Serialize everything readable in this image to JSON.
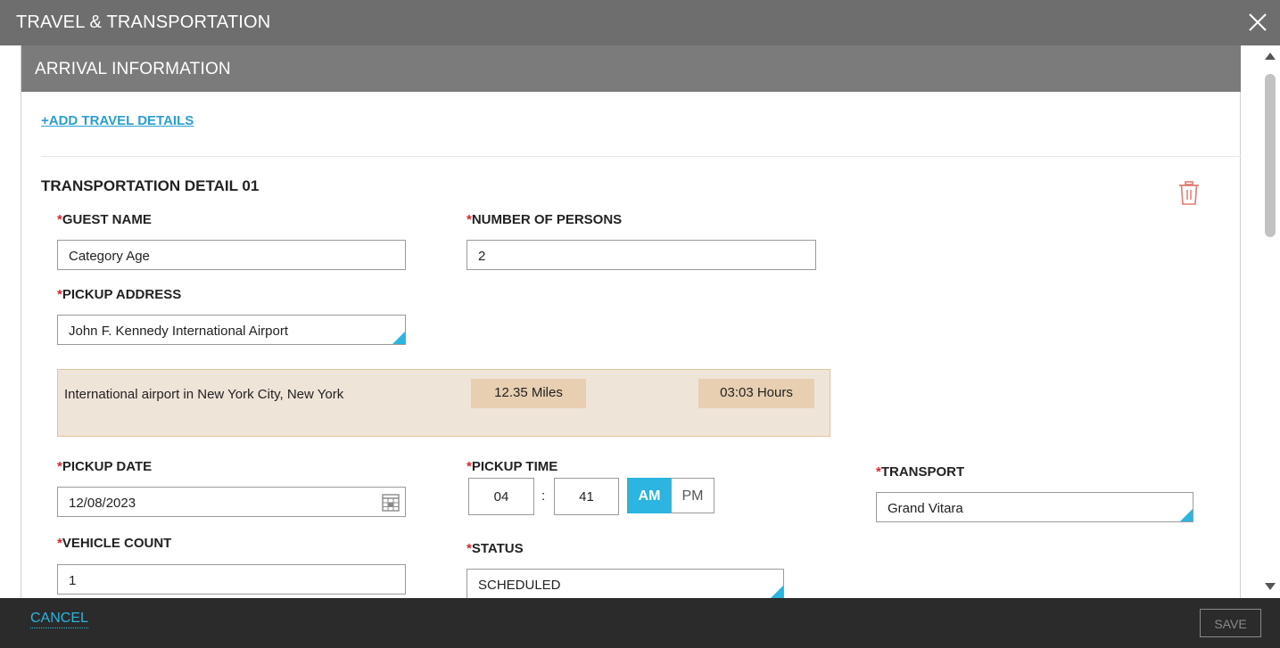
{
  "header": {
    "title": "TRAVEL & TRANSPORTATION"
  },
  "section": {
    "title": "ARRIVAL INFORMATION",
    "add_link": "+ADD TRAVEL DETAILS",
    "detail_title": "TRANSPORTATION DETAIL 01"
  },
  "form": {
    "guest_name": {
      "label": "GUEST NAME",
      "value": "Category Age"
    },
    "num_persons": {
      "label": "NUMBER OF PERSONS",
      "value": "2"
    },
    "pickup_address": {
      "label": "PICKUP ADDRESS",
      "value": "John F. Kennedy International Airport"
    },
    "info": {
      "description": "International airport in New York City, New York",
      "distance": "12.35 Miles",
      "duration": "03:03 Hours"
    },
    "pickup_date": {
      "label": "PICKUP DATE",
      "value": "12/08/2023"
    },
    "pickup_time": {
      "label": "PICKUP TIME",
      "hour": "04",
      "separator": ":",
      "minute": "41",
      "am": "AM",
      "pm": "PM",
      "selected": "AM"
    },
    "transport": {
      "label": "TRANSPORT",
      "value": "Grand Vitara"
    },
    "vehicle_count": {
      "label": "VEHICLE COUNT",
      "value": "1"
    },
    "status": {
      "label": "STATUS",
      "value": "SCHEDULED"
    },
    "required_mark": "*"
  },
  "footer": {
    "cancel": "CANCEL",
    "save": "SAVE"
  },
  "colors": {
    "accent": "#2bb5e0",
    "header": "#6e6e6e",
    "section_header": "#7b7b7b",
    "required": "#d9262b",
    "info_bg": "#efe4d8",
    "footer_bg": "#2b2b2b"
  },
  "icons": {
    "close": "close-icon",
    "trash": "trash-icon",
    "calendar": "calendar-icon"
  }
}
